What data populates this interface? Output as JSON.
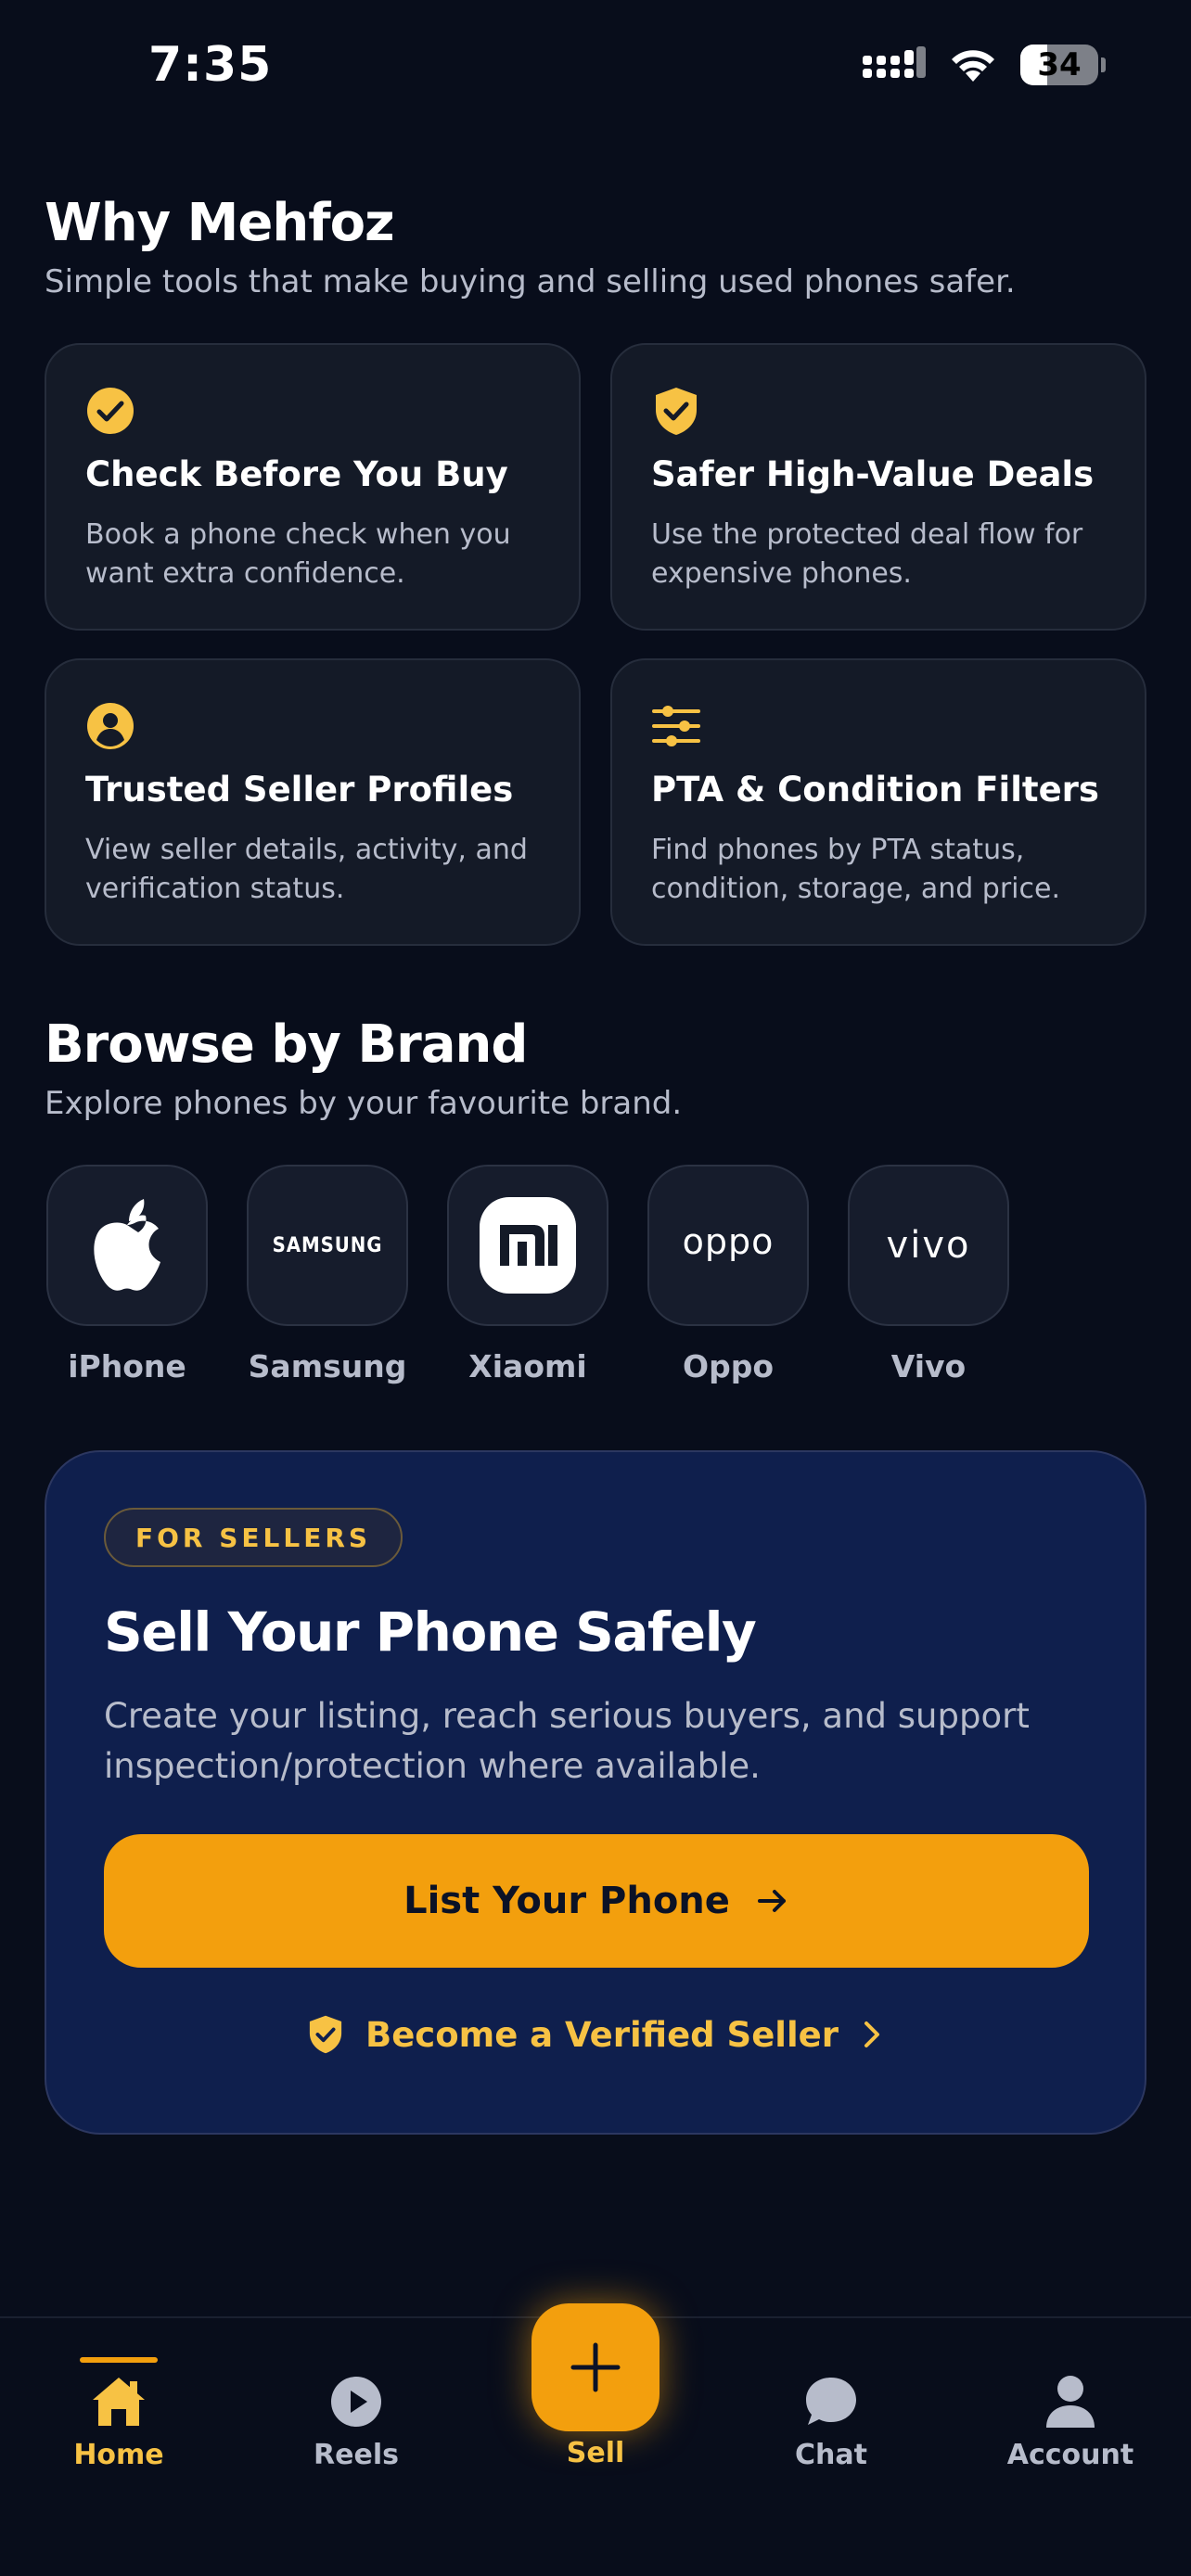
{
  "status_bar": {
    "time": "7:35",
    "battery": "34",
    "battery_level": 0.34,
    "icons": [
      "cellular-signal-icon",
      "wifi-icon",
      "battery-icon"
    ]
  },
  "colors": {
    "background": "#080d1b",
    "card": "#141a27",
    "accent": "#f39f0d",
    "accent_text": "#f7c244",
    "seller_card": "#0f1f4d",
    "muted_text": "#b7bccb"
  },
  "why": {
    "title": "Why Mehfoz",
    "subtitle": "Simple tools that make buying and selling used phones safer.",
    "features": [
      {
        "icon": "check-circle-icon",
        "title": "Check Before You Buy",
        "desc": "Book a phone check when you want extra confidence."
      },
      {
        "icon": "shield-check-icon",
        "title": "Safer High-Value Deals",
        "desc": "Use the protected deal flow for expensive phones."
      },
      {
        "icon": "user-circle-icon",
        "title": "Trusted Seller Profiles",
        "desc": "View seller details, activity, and verification status."
      },
      {
        "icon": "sliders-icon",
        "title": "PTA & Condition Filters",
        "desc": "Find phones by PTA status, condition, storage, and price."
      }
    ]
  },
  "brands": {
    "title": "Browse by Brand",
    "subtitle": "Explore phones by your favourite brand.",
    "items": [
      {
        "label": "iPhone",
        "icon": "apple-logo-icon"
      },
      {
        "label": "Samsung",
        "icon": "samsung-logo-icon",
        "logo_text": "SAMSUNG"
      },
      {
        "label": "Xiaomi",
        "icon": "xiaomi-logo-icon"
      },
      {
        "label": "Oppo",
        "icon": "oppo-logo-icon",
        "logo_text": "oppo"
      },
      {
        "label": "Vivo",
        "icon": "vivo-logo-icon",
        "logo_text": "vivo"
      }
    ]
  },
  "seller": {
    "badge": "FOR SELLERS",
    "title": "Sell Your Phone Safely",
    "desc": "Create your listing, reach serious buyers, and support inspection/protection where available.",
    "cta_label": "List Your Phone",
    "cta_icon": "arrow-right-icon",
    "link_label": "Become a Verified Seller",
    "link_icon": "shield-check-icon",
    "link_chevron": "chevron-right-icon"
  },
  "tabs": [
    {
      "label": "Home",
      "icon": "home-icon",
      "active": true
    },
    {
      "label": "Reels",
      "icon": "play-circle-icon",
      "active": false
    },
    {
      "label": "Sell",
      "icon": "plus-icon",
      "active": false
    },
    {
      "label": "Chat",
      "icon": "chat-bubble-icon",
      "active": false
    },
    {
      "label": "Account",
      "icon": "user-icon",
      "active": false
    }
  ]
}
